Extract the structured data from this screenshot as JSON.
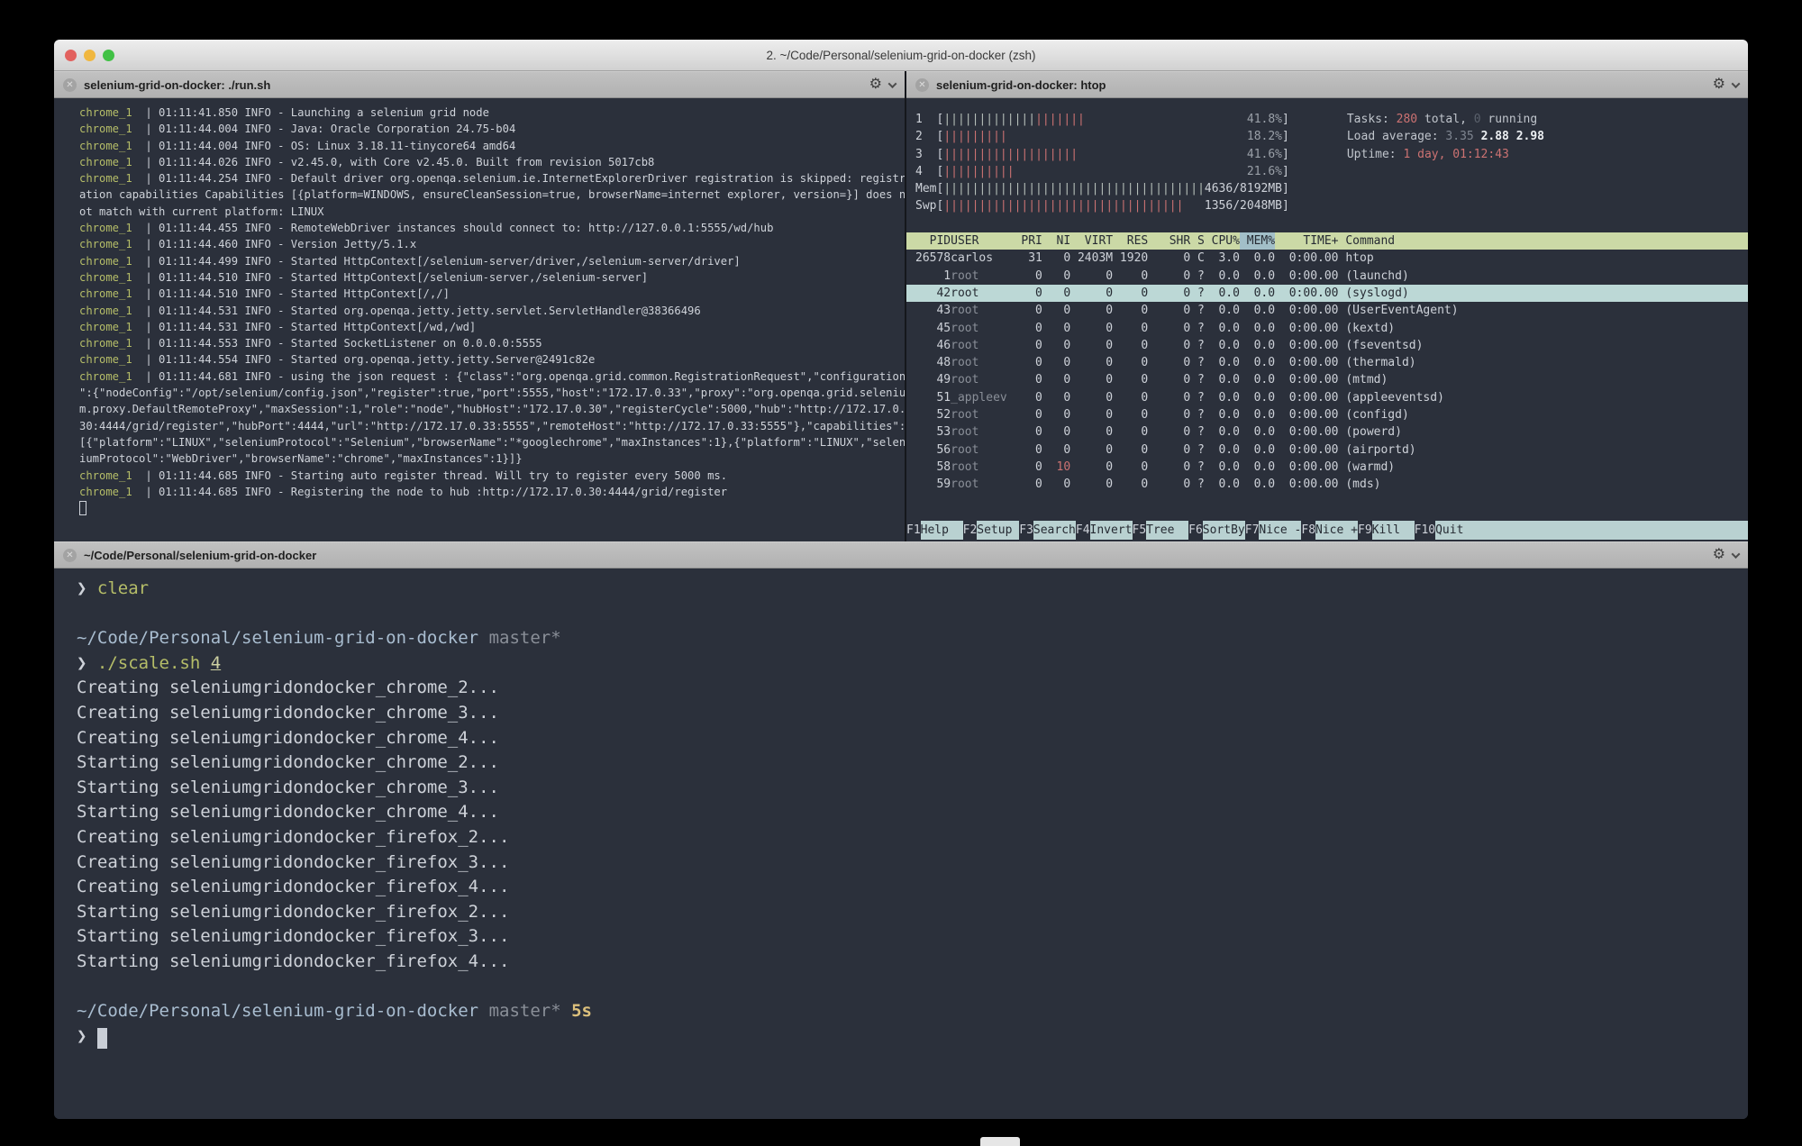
{
  "palette": {
    "bg": "#2b303b",
    "fg": "#ced2d9",
    "dim": "#8a8f98",
    "green": "#b5bd68",
    "blue": "#a9bdd0",
    "yellow": "#dcc07c",
    "arg": "#cdd0a2",
    "red": "#cc7272",
    "bargray": "#b6bfb9",
    "pct": "#9aa0a8",
    "hlabel": "#c0c5cc",
    "bright": "#edf0f3",
    "vdim": "#5a616c",
    "vdim2": "#7e8590",
    "hdrbg": "#cbd9a6",
    "sortbg": "#a2bfc8",
    "selbg": "#bcd8d6",
    "darktext": "#262b33",
    "fkeybg": "#b9d1d1",
    "cursor": "#c9ced6",
    "titlebar_text": "#3a3a3a",
    "traffic_red": "#e2615e",
    "traffic_yellow": "#f0b73f",
    "traffic_green": "#41c145"
  },
  "window": {
    "title": "2. ~/Code/Personal/selenium-grid-on-docker (zsh)",
    "close_glyph": "✕",
    "gear_glyph": "⚙"
  },
  "left_pane": {
    "title": "selenium-grid-on-docker: ./run.sh",
    "lines": [
      {
        "segs": [
          {
            "t": "chrome_1",
            "c": "green"
          },
          {
            "t": "  | 01:11:41.850 INFO - Launching a selenium grid node",
            "c": "fg"
          }
        ]
      },
      {
        "segs": [
          {
            "t": "chrome_1",
            "c": "green"
          },
          {
            "t": "  | 01:11:44.004 INFO - Java: Oracle Corporation 24.75-b04",
            "c": "fg"
          }
        ]
      },
      {
        "segs": [
          {
            "t": "chrome_1",
            "c": "green"
          },
          {
            "t": "  | 01:11:44.004 INFO - OS: Linux 3.18.11-tinycore64 amd64",
            "c": "fg"
          }
        ]
      },
      {
        "segs": [
          {
            "t": "chrome_1",
            "c": "green"
          },
          {
            "t": "  | 01:11:44.026 INFO - v2.45.0, with Core v2.45.0. Built from revision 5017cb8",
            "c": "fg"
          }
        ]
      },
      {
        "segs": [
          {
            "t": "chrome_1",
            "c": "green"
          },
          {
            "t": "  | 01:11:44.254 INFO - Default driver org.openqa.selenium.ie.InternetExplorerDriver registration is skipped: registr",
            "c": "fg"
          }
        ]
      },
      {
        "segs": [
          {
            "t": "ation capabilities Capabilities [{platform=WINDOWS, ensureCleanSession=true, browserName=internet explorer, version=}] does n",
            "c": "fg"
          }
        ]
      },
      {
        "segs": [
          {
            "t": "ot match with current platform: LINUX",
            "c": "fg"
          }
        ]
      },
      {
        "segs": [
          {
            "t": "chrome_1",
            "c": "green"
          },
          {
            "t": "  | 01:11:44.455 INFO - RemoteWebDriver instances should connect to: http://127.0.0.1:5555/wd/hub",
            "c": "fg"
          }
        ]
      },
      {
        "segs": [
          {
            "t": "chrome_1",
            "c": "green"
          },
          {
            "t": "  | 01:11:44.460 INFO - Version Jetty/5.1.x",
            "c": "fg"
          }
        ]
      },
      {
        "segs": [
          {
            "t": "chrome_1",
            "c": "green"
          },
          {
            "t": "  | 01:11:44.499 INFO - Started HttpContext[/selenium-server/driver,/selenium-server/driver]",
            "c": "fg"
          }
        ]
      },
      {
        "segs": [
          {
            "t": "chrome_1",
            "c": "green"
          },
          {
            "t": "  | 01:11:44.510 INFO - Started HttpContext[/selenium-server,/selenium-server]",
            "c": "fg"
          }
        ]
      },
      {
        "segs": [
          {
            "t": "chrome_1",
            "c": "green"
          },
          {
            "t": "  | 01:11:44.510 INFO - Started HttpContext[/,/]",
            "c": "fg"
          }
        ]
      },
      {
        "segs": [
          {
            "t": "chrome_1",
            "c": "green"
          },
          {
            "t": "  | 01:11:44.531 INFO - Started org.openqa.jetty.jetty.servlet.ServletHandler@38366496",
            "c": "fg"
          }
        ]
      },
      {
        "segs": [
          {
            "t": "chrome_1",
            "c": "green"
          },
          {
            "t": "  | 01:11:44.531 INFO - Started HttpContext[/wd,/wd]",
            "c": "fg"
          }
        ]
      },
      {
        "segs": [
          {
            "t": "chrome_1",
            "c": "green"
          },
          {
            "t": "  | 01:11:44.553 INFO - Started SocketListener on 0.0.0.0:5555",
            "c": "fg"
          }
        ]
      },
      {
        "segs": [
          {
            "t": "chrome_1",
            "c": "green"
          },
          {
            "t": "  | 01:11:44.554 INFO - Started org.openqa.jetty.jetty.Server@2491c82e",
            "c": "fg"
          }
        ]
      },
      {
        "segs": [
          {
            "t": "chrome_1",
            "c": "green"
          },
          {
            "t": "  | 01:11:44.681 INFO - using the json request : {\"class\":\"org.openqa.grid.common.RegistrationRequest\",\"configuration",
            "c": "fg"
          }
        ]
      },
      {
        "segs": [
          {
            "t": "\":{\"nodeConfig\":\"/opt/selenium/config.json\",\"register\":true,\"port\":5555,\"host\":\"172.17.0.33\",\"proxy\":\"org.openqa.grid.seleniu",
            "c": "fg"
          }
        ]
      },
      {
        "segs": [
          {
            "t": "m.proxy.DefaultRemoteProxy\",\"maxSession\":1,\"role\":\"node\",\"hubHost\":\"172.17.0.30\",\"registerCycle\":5000,\"hub\":\"http://172.17.0.",
            "c": "fg"
          }
        ]
      },
      {
        "segs": [
          {
            "t": "30:4444/grid/register\",\"hubPort\":4444,\"url\":\"http://172.17.0.33:5555\",\"remoteHost\":\"http://172.17.0.33:5555\"},\"capabilities\":",
            "c": "fg"
          }
        ]
      },
      {
        "segs": [
          {
            "t": "[{\"platform\":\"LINUX\",\"seleniumProtocol\":\"Selenium\",\"browserName\":\"*googlechrome\",\"maxInstances\":1},{\"platform\":\"LINUX\",\"selen",
            "c": "fg"
          }
        ]
      },
      {
        "segs": [
          {
            "t": "iumProtocol\":\"WebDriver\",\"browserName\":\"chrome\",\"maxInstances\":1}]}",
            "c": "fg"
          }
        ]
      },
      {
        "segs": [
          {
            "t": "chrome_1",
            "c": "green"
          },
          {
            "t": "  | 01:11:44.685 INFO - Starting auto register thread. Will try to register every 5000 ms.",
            "c": "fg"
          }
        ]
      },
      {
        "segs": [
          {
            "t": "chrome_1",
            "c": "green"
          },
          {
            "t": "  | 01:11:44.685 INFO - Registering the node to hub :http://172.17.0.30:4444/grid/register",
            "c": "fg"
          }
        ]
      },
      {
        "segs": [
          {
            "t": " ",
            "c": "cursorHollow"
          }
        ]
      }
    ]
  },
  "htop_pane": {
    "title": "selenium-grid-on-docker: htop",
    "meter_inner_width": 48,
    "meters": [
      {
        "label": "1  ",
        "bars": [
          [
            13,
            "gray"
          ],
          [
            7,
            "red"
          ]
        ],
        "value": "41.8%",
        "value_style": "pct"
      },
      {
        "label": "2  ",
        "bars": [
          [
            9,
            "red"
          ]
        ],
        "value": "18.2%",
        "value_style": "pct"
      },
      {
        "label": "3  ",
        "bars": [
          [
            13,
            "red"
          ],
          [
            6,
            "red"
          ]
        ],
        "value": "41.6%",
        "value_style": "pct"
      },
      {
        "label": "4  ",
        "bars": [
          [
            10,
            "red"
          ]
        ],
        "value": "21.6%",
        "value_style": "pct"
      },
      {
        "label": "Mem",
        "bars": [
          [
            37,
            "gray"
          ]
        ],
        "value": "4636/8192MB",
        "value_style": "val"
      },
      {
        "label": "Swp",
        "bars": [
          [
            34,
            "red"
          ]
        ],
        "value": "1356/2048MB",
        "value_style": "val"
      }
    ],
    "summary_lines": [
      {
        "segs": [
          {
            "t": "Tasks: ",
            "c": "hlabel"
          },
          {
            "t": "280",
            "c": "red"
          },
          {
            "t": " total, ",
            "c": "hlabel"
          },
          {
            "t": "0",
            "c": "vdim"
          },
          {
            "t": " running",
            "c": "hlabel"
          }
        ]
      },
      {
        "segs": [
          {
            "t": "Load average: ",
            "c": "hlabel"
          },
          {
            "t": "3.35 ",
            "c": "vdim2"
          },
          {
            "t": "2.88 ",
            "c": "bright"
          },
          {
            "t": "2.98",
            "c": "bright"
          }
        ]
      },
      {
        "segs": [
          {
            "t": "Uptime: ",
            "c": "hlabel"
          },
          {
            "t": "1 day, 01:12:43",
            "c": "red"
          }
        ]
      }
    ],
    "table": {
      "columns": [
        {
          "label": "PID",
          "w": 5,
          "a": "r"
        },
        {
          "label": "USER",
          "w": 10,
          "a": "l"
        },
        {
          "label": "PRI",
          "w": 3,
          "a": "r"
        },
        {
          "label": "NI",
          "w": 4,
          "a": "r"
        },
        {
          "label": "VIRT",
          "w": 6,
          "a": "r"
        },
        {
          "label": "RES",
          "w": 5,
          "a": "r"
        },
        {
          "label": "SHR",
          "w": 6,
          "a": "r"
        },
        {
          "label": "S",
          "w": 2,
          "a": "r"
        },
        {
          "label": "CPU%",
          "w": 5,
          "a": "r"
        },
        {
          "label": "MEM%",
          "w": 5,
          "a": "r"
        },
        {
          "label": "TIME+",
          "w": 9,
          "a": "r"
        },
        {
          "label": "Command",
          "w": 0,
          "a": "l"
        }
      ],
      "sort_column": "MEM%",
      "selected_index": 2,
      "red_ni_row": 12,
      "rows": [
        [
          "26578",
          "carlos",
          "31",
          "0",
          "2403M",
          "1920",
          "0",
          "C",
          "3.0",
          "0.0",
          "0:00.00",
          "htop"
        ],
        [
          "1",
          "root",
          "0",
          "0",
          "0",
          "0",
          "0",
          "?",
          "0.0",
          "0.0",
          "0:00.00",
          "(launchd)"
        ],
        [
          "42",
          "root",
          "0",
          "0",
          "0",
          "0",
          "0",
          "?",
          "0.0",
          "0.0",
          "0:00.00",
          "(syslogd)"
        ],
        [
          "43",
          "root",
          "0",
          "0",
          "0",
          "0",
          "0",
          "?",
          "0.0",
          "0.0",
          "0:00.00",
          "(UserEventAgent)"
        ],
        [
          "45",
          "root",
          "0",
          "0",
          "0",
          "0",
          "0",
          "?",
          "0.0",
          "0.0",
          "0:00.00",
          "(kextd)"
        ],
        [
          "46",
          "root",
          "0",
          "0",
          "0",
          "0",
          "0",
          "?",
          "0.0",
          "0.0",
          "0:00.00",
          "(fseventsd)"
        ],
        [
          "48",
          "root",
          "0",
          "0",
          "0",
          "0",
          "0",
          "?",
          "0.0",
          "0.0",
          "0:00.00",
          "(thermald)"
        ],
        [
          "49",
          "root",
          "0",
          "0",
          "0",
          "0",
          "0",
          "?",
          "0.0",
          "0.0",
          "0:00.00",
          "(mtmd)"
        ],
        [
          "51",
          "_appleev",
          "0",
          "0",
          "0",
          "0",
          "0",
          "?",
          "0.0",
          "0.0",
          "0:00.00",
          "(appleeventsd)"
        ],
        [
          "52",
          "root",
          "0",
          "0",
          "0",
          "0",
          "0",
          "?",
          "0.0",
          "0.0",
          "0:00.00",
          "(configd)"
        ],
        [
          "53",
          "root",
          "0",
          "0",
          "0",
          "0",
          "0",
          "?",
          "0.0",
          "0.0",
          "0:00.00",
          "(powerd)"
        ],
        [
          "56",
          "root",
          "0",
          "0",
          "0",
          "0",
          "0",
          "?",
          "0.0",
          "0.0",
          "0:00.00",
          "(airportd)"
        ],
        [
          "58",
          "root",
          "0",
          "10",
          "0",
          "0",
          "0",
          "?",
          "0.0",
          "0.0",
          "0:00.00",
          "(warmd)"
        ],
        [
          "59",
          "root",
          "0",
          "0",
          "0",
          "0",
          "0",
          "?",
          "0.0",
          "0.0",
          "0:00.00",
          "(mds)"
        ]
      ]
    },
    "fkeys": [
      {
        "key": "F1",
        "label": "Help  "
      },
      {
        "key": "F2",
        "label": "Setup "
      },
      {
        "key": "F3",
        "label": "Search"
      },
      {
        "key": "F4",
        "label": "Invert"
      },
      {
        "key": "F5",
        "label": "Tree  "
      },
      {
        "key": "F6",
        "label": "SortBy"
      },
      {
        "key": "F7",
        "label": "Nice -"
      },
      {
        "key": "F8",
        "label": "Nice +"
      },
      {
        "key": "F9",
        "label": "Kill  "
      },
      {
        "key": "F10",
        "label": "Quit  "
      }
    ]
  },
  "bottom_pane": {
    "title": "~/Code/Personal/selenium-grid-on-docker",
    "lines": [
      {
        "segs": [
          {
            "t": "❯ ",
            "c": "fg"
          },
          {
            "t": "clear",
            "c": "green"
          }
        ]
      },
      {
        "segs": []
      },
      {
        "segs": [
          {
            "t": "~/Code/Personal/selenium-grid-on-docker",
            "c": "blue"
          },
          {
            "t": " ",
            "c": "fg"
          },
          {
            "t": "master*",
            "c": "dim"
          }
        ]
      },
      {
        "segs": [
          {
            "t": "❯ ",
            "c": "fg"
          },
          {
            "t": "./scale.sh ",
            "c": "green"
          },
          {
            "t": "4",
            "c": "arg",
            "u": true
          }
        ]
      },
      {
        "segs": [
          {
            "t": "Creating seleniumgridondocker_chrome_2...",
            "c": "fg"
          }
        ]
      },
      {
        "segs": [
          {
            "t": "Creating seleniumgridondocker_chrome_3...",
            "c": "fg"
          }
        ]
      },
      {
        "segs": [
          {
            "t": "Creating seleniumgridondocker_chrome_4...",
            "c": "fg"
          }
        ]
      },
      {
        "segs": [
          {
            "t": "Starting seleniumgridondocker_chrome_2...",
            "c": "fg"
          }
        ]
      },
      {
        "segs": [
          {
            "t": "Starting seleniumgridondocker_chrome_3...",
            "c": "fg"
          }
        ]
      },
      {
        "segs": [
          {
            "t": "Starting seleniumgridondocker_chrome_4...",
            "c": "fg"
          }
        ]
      },
      {
        "segs": [
          {
            "t": "Creating seleniumgridondocker_firefox_2...",
            "c": "fg"
          }
        ]
      },
      {
        "segs": [
          {
            "t": "Creating seleniumgridondocker_firefox_3...",
            "c": "fg"
          }
        ]
      },
      {
        "segs": [
          {
            "t": "Creating seleniumgridondocker_firefox_4...",
            "c": "fg"
          }
        ]
      },
      {
        "segs": [
          {
            "t": "Starting seleniumgridondocker_firefox_2...",
            "c": "fg"
          }
        ]
      },
      {
        "segs": [
          {
            "t": "Starting seleniumgridondocker_firefox_3...",
            "c": "fg"
          }
        ]
      },
      {
        "segs": [
          {
            "t": "Starting seleniumgridondocker_firefox_4...",
            "c": "fg"
          }
        ]
      },
      {
        "segs": []
      },
      {
        "segs": [
          {
            "t": "~/Code/Personal/selenium-grid-on-docker",
            "c": "blue"
          },
          {
            "t": " ",
            "c": "fg"
          },
          {
            "t": "master*",
            "c": "dim"
          },
          {
            "t": " ",
            "c": "fg"
          },
          {
            "t": "5s",
            "c": "yellow"
          }
        ]
      },
      {
        "segs": [
          {
            "t": "❯ ",
            "c": "fg"
          },
          {
            "t": " ",
            "c": "cursorBlock"
          }
        ]
      }
    ]
  }
}
